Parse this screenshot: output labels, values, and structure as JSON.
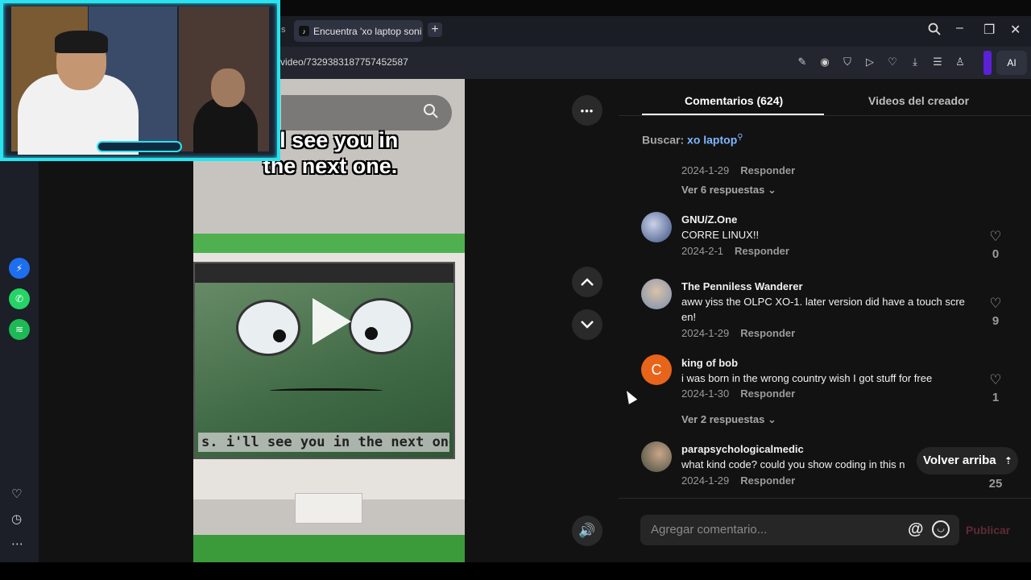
{
  "browser": {
    "tab_prev_fragment": "s",
    "tab_title": "Encuentra 'xo laptop soni",
    "tab_icon": "tiktok-icon",
    "new_tab": "+",
    "url": "video/7329383187757452587",
    "ai_label": "AI"
  },
  "video": {
    "caption_line1": "I'll see you in",
    "caption_line2": "the next one.",
    "subtitle": "s. i'll see you in the next one",
    "more_icon": "•••"
  },
  "sidebar": {
    "apps": [
      "messenger-icon",
      "whatsapp-icon",
      "spotify-icon"
    ]
  },
  "panel": {
    "tab_comments": "Comentarios (624)",
    "tab_creator": "Videos del creador",
    "search_label": "Buscar:",
    "search_query": "xo laptop",
    "volver": "Volver arriba",
    "input_placeholder": "Agregar comentario...",
    "publicar": "Publicar",
    "at": "@"
  },
  "comments": {
    "top": {
      "date": "2024-1-29",
      "reply": "Responder",
      "view_replies": "Ver 6 respuestas"
    },
    "c1": {
      "name": "GNU/Z.One",
      "text": "CORRE LINUX!!",
      "date": "2024-2-1",
      "reply": "Responder",
      "likes": "0"
    },
    "c2": {
      "name": "The Penniless Wanderer",
      "text1": "aww yiss the OLPC XO-1. later version did have a touch scre",
      "text2": "en!",
      "date": "2024-1-29",
      "reply": "Responder",
      "likes": "9"
    },
    "c3": {
      "name": "king of bob",
      "initial": "C",
      "text": "i was born in the wrong country wish I got stuff for free",
      "date": "2024-1-30",
      "reply": "Responder",
      "likes": "1",
      "view_replies": "Ver 2 respuestas"
    },
    "c4": {
      "name": "parapsychologicalmedic",
      "text": "what kind code? could you show coding in this n",
      "date": "2024-1-29",
      "reply": "Responder",
      "likes": "25"
    }
  },
  "colors": {
    "accent_link": "#7fb7ff",
    "webcam_frame": "#29e3f0",
    "avatar_orange": "#e8641a"
  }
}
